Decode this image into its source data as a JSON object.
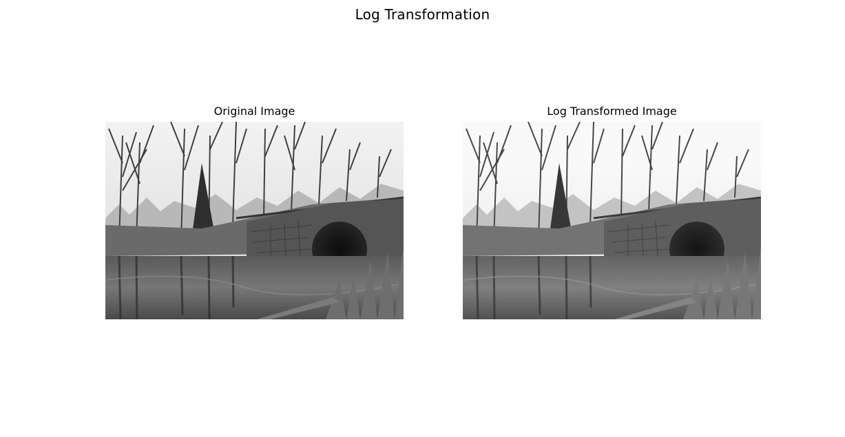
{
  "figure": {
    "title": "Log Transformation"
  },
  "panels": [
    {
      "title": "Original Image",
      "image_description": "grayscale photo of a stone arch bridge over a river with bare trees and reflections"
    },
    {
      "title": "Log Transformed Image",
      "image_description": "same scene, slightly brighter due to log transformation"
    }
  ],
  "colors": {
    "background": "#ffffff",
    "text": "#000000"
  }
}
